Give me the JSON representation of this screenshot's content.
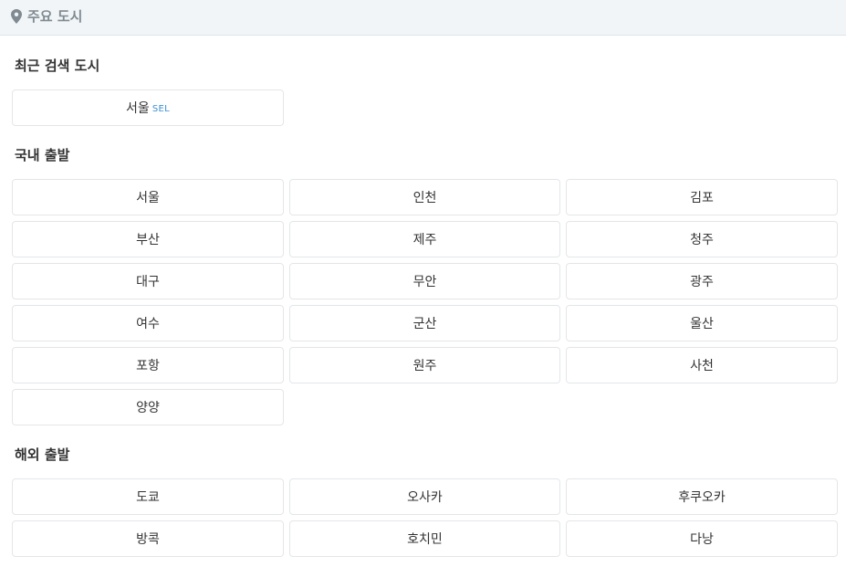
{
  "header": {
    "icon": "map-pin-icon",
    "title": "주요 도시",
    "icon_color": "#7f8a92"
  },
  "recent": {
    "title": "최근 검색 도시",
    "items": [
      {
        "name": "서울",
        "code": "SEL"
      }
    ]
  },
  "domestic": {
    "title": "국내 출발",
    "cities": [
      "서울",
      "인천",
      "김포",
      "부산",
      "제주",
      "청주",
      "대구",
      "무안",
      "광주",
      "여수",
      "군산",
      "울산",
      "포항",
      "원주",
      "사천",
      "양양"
    ]
  },
  "international": {
    "title": "해외 출발",
    "cities": [
      "도쿄",
      "오사카",
      "후쿠오카",
      "방콕",
      "호치민",
      "다낭"
    ]
  },
  "colors": {
    "header_bg": "#f1f5f7",
    "border": "#e3e6e8",
    "code_accent": "#3b8fd1"
  }
}
